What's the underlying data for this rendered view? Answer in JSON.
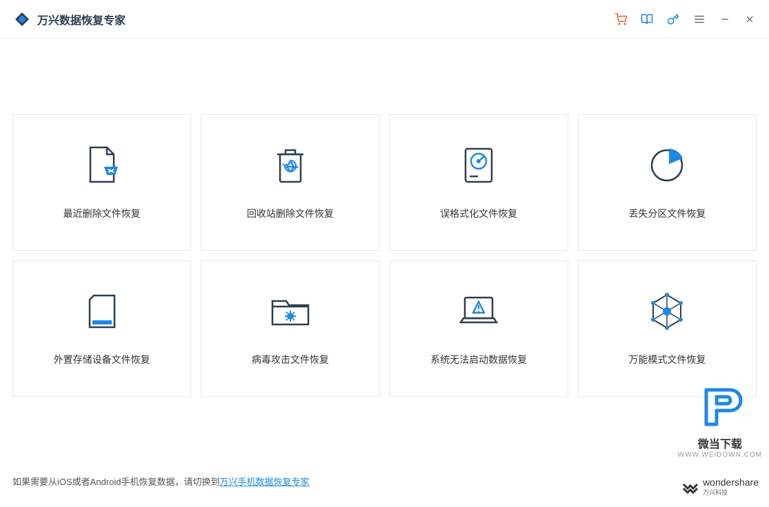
{
  "header": {
    "title": "万兴数据恢复专家"
  },
  "cards": [
    {
      "label": "最近删除文件恢复"
    },
    {
      "label": "回收站删除文件恢复"
    },
    {
      "label": "误格式化文件恢复"
    },
    {
      "label": "丢失分区文件恢复"
    },
    {
      "label": "外置存储设备文件恢复"
    },
    {
      "label": "病毒攻击文件恢复"
    },
    {
      "label": "系统无法启动数据恢复"
    },
    {
      "label": "万能模式文件恢复"
    }
  ],
  "footer": {
    "text_prefix": "如果需要从iOS或者Android手机恢复数据，请切换到",
    "link_text": "万兴手机数据恢复专家"
  },
  "watermark": {
    "main": "微当下载",
    "sub": "WWW.WEIDOWN.COM"
  },
  "brand": {
    "main": "wondershare",
    "sub": "万兴科技"
  }
}
